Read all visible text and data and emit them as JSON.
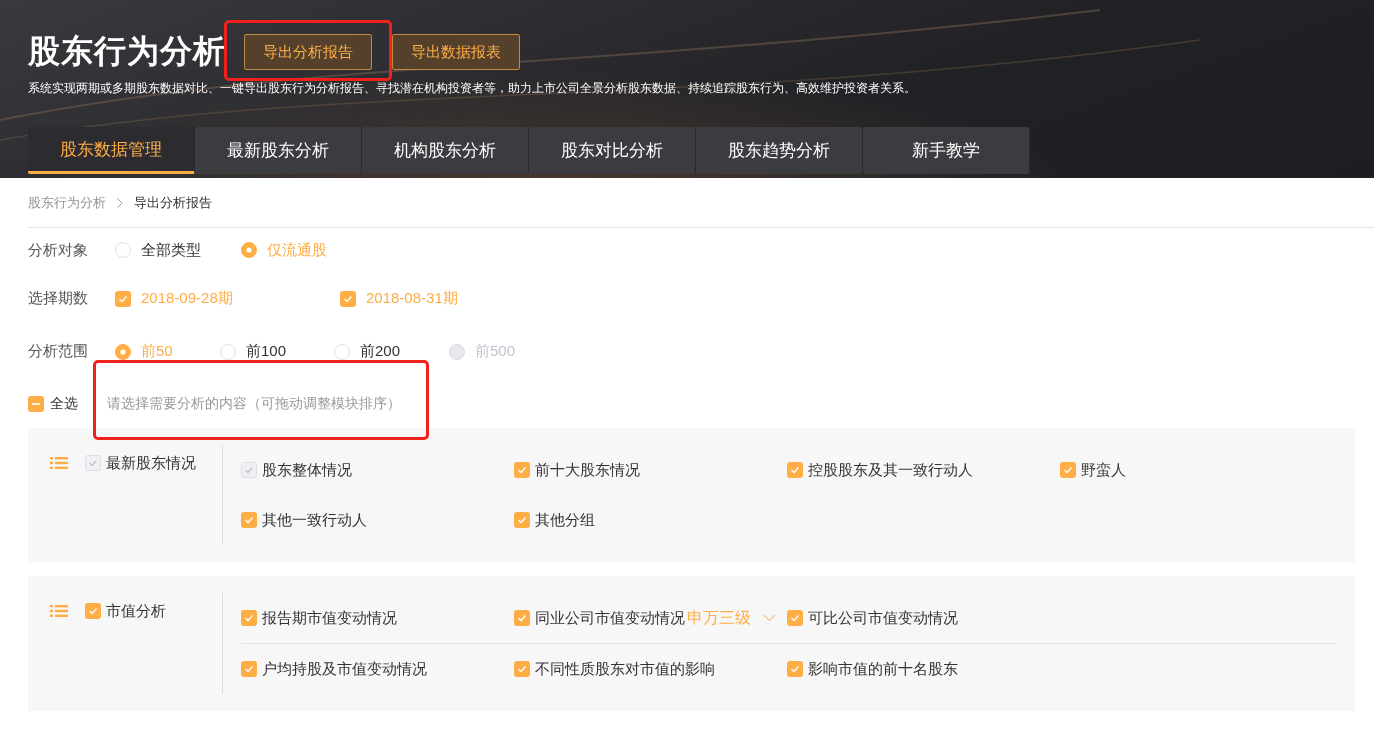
{
  "header": {
    "title": "股东行为分析",
    "buttons": [
      {
        "label": "导出分析报告",
        "highlighted": true
      },
      {
        "label": "导出数据报表",
        "highlighted": false
      }
    ],
    "description": "系统实现两期或多期股东数据对比、一键导出股东行为分析报告、寻找潜在机构投资者等，助力上市公司全景分析股东数据、持续追踪股东行为、高效维护投资者关系。"
  },
  "tabs": [
    {
      "label": "股东数据管理",
      "selected": true
    },
    {
      "label": "最新股东分析",
      "selected": false
    },
    {
      "label": "机构股东分析",
      "selected": false
    },
    {
      "label": "股东对比分析",
      "selected": false
    },
    {
      "label": "股东趋势分析",
      "selected": false
    },
    {
      "label": "新手教学",
      "selected": false
    }
  ],
  "breadcrumb": [
    "股东行为分析",
    "导出分析报告"
  ],
  "form_rows": [
    {
      "label": "分析对象",
      "kind": "radio",
      "options": [
        {
          "label": "全部类型",
          "selected": false,
          "disabled": false
        },
        {
          "label": "仅流通股",
          "selected": true,
          "disabled": false
        }
      ]
    },
    {
      "label": "选择期数",
      "kind": "checkbox",
      "options": [
        {
          "label": "2018-09-28期",
          "checked": true
        },
        {
          "label": "2018-08-31期",
          "checked": true
        }
      ]
    },
    {
      "label": "分析范围",
      "kind": "radio",
      "options": [
        {
          "label": "前50",
          "selected": true,
          "disabled": false
        },
        {
          "label": "前100",
          "selected": false,
          "disabled": false
        },
        {
          "label": "前200",
          "selected": false,
          "disabled": false
        },
        {
          "label": "前500",
          "selected": false,
          "disabled": true
        }
      ]
    }
  ],
  "select_all": {
    "label": "全选",
    "indeterminate": true
  },
  "hint": {
    "text": "请选择需要分析的内容（可拖动调整模块排序）",
    "highlighted": true
  },
  "groups": [
    {
      "title": "最新股东情况",
      "checked": true,
      "disabled": true,
      "rows": [
        [
          {
            "label": "股东整体情况",
            "checked": true,
            "disabled": true
          },
          {
            "label": "前十大股东情况",
            "checked": true,
            "disabled": false
          },
          {
            "label": "控股股东及其一致行动人",
            "checked": true,
            "disabled": false
          },
          {
            "label": "野蛮人",
            "checked": true,
            "disabled": false
          }
        ],
        [
          {
            "label": "其他一致行动人",
            "checked": true,
            "disabled": false
          },
          {
            "label": "其他分组",
            "checked": true,
            "disabled": false
          }
        ]
      ]
    },
    {
      "title": "市值分析",
      "checked": true,
      "disabled": false,
      "rows": [
        [
          {
            "label": "报告期市值变动情况",
            "checked": true,
            "disabled": false
          },
          {
            "label": "同业公司市值变动情况",
            "checked": true,
            "disabled": false,
            "dropdown": "申万三级"
          },
          {
            "label": "可比公司市值变动情况",
            "checked": true,
            "disabled": false
          }
        ],
        [
          {
            "label": "户均持股及市值变动情况",
            "checked": true,
            "disabled": false
          },
          {
            "label": "不同性质股东对市值的影响",
            "checked": true,
            "disabled": false
          },
          {
            "label": "影响市值的前十名股东",
            "checked": true,
            "disabled": false
          }
        ]
      ]
    }
  ]
}
